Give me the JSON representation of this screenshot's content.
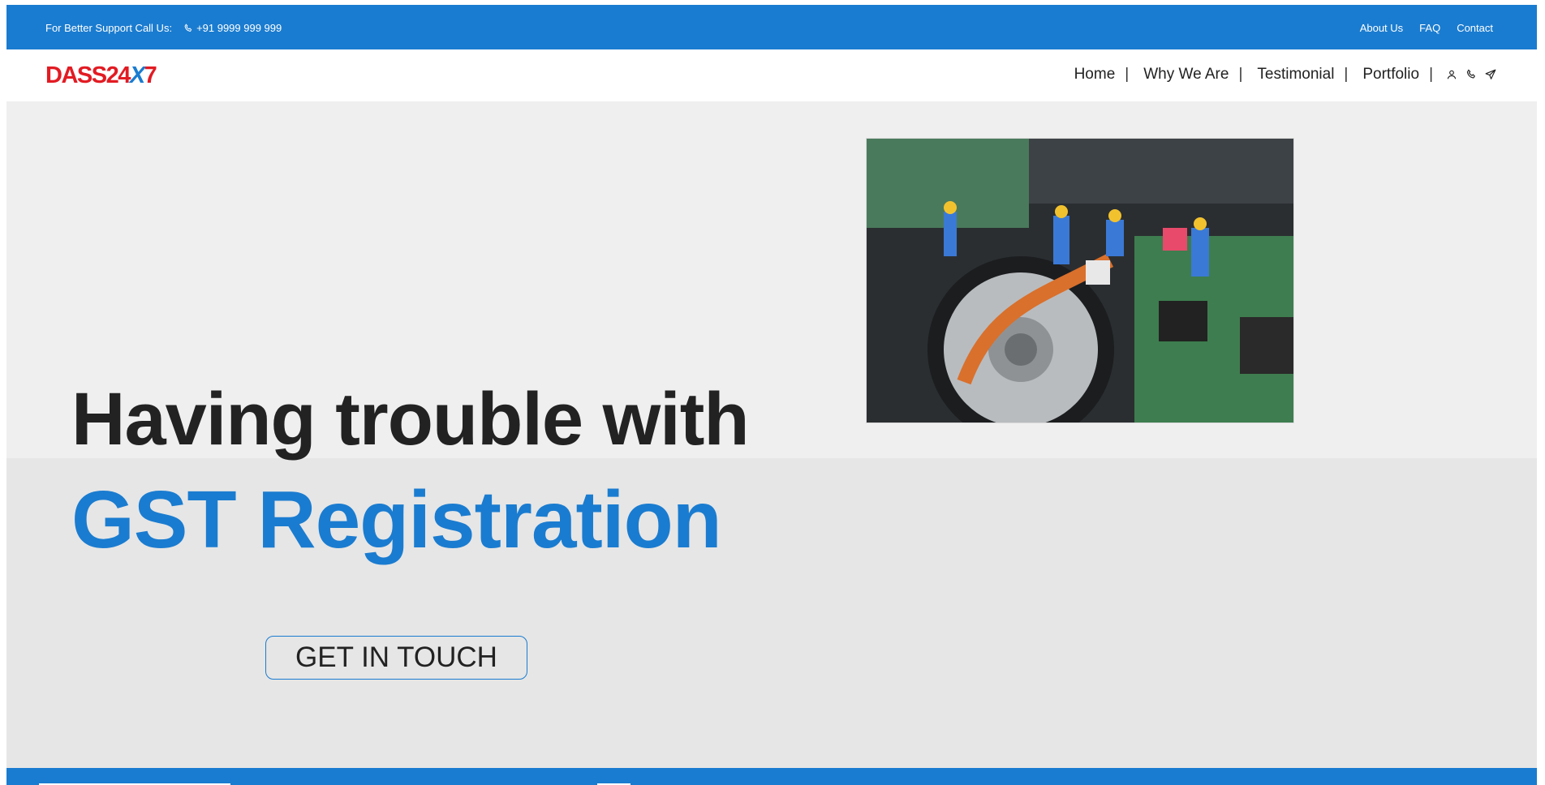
{
  "topbar": {
    "support_label": "For Better Support Call Us:",
    "phone": "+91 9999 999 999",
    "links": [
      "About Us",
      "FAQ",
      "Contact"
    ]
  },
  "brand": {
    "logo_prefix": "DASS24",
    "logo_x": "X",
    "logo_suffix": "7"
  },
  "nav": {
    "items": [
      "Home",
      "Why We Are",
      "Testimonial",
      "Portfolio"
    ],
    "icons": [
      "user-icon",
      "phone-icon",
      "send-icon"
    ]
  },
  "hero": {
    "headline_line1": "Having trouble with",
    "headline_line2": "GST Registration",
    "cta_label": "GET IN TOUCH",
    "image_icon": "hard-drive-repair-workers-photo"
  },
  "colors": {
    "primary_blue": "#1a7cd0",
    "logo_red": "#e21b23",
    "hero_bg": "#e6e6e6",
    "text_dark": "#222222"
  }
}
